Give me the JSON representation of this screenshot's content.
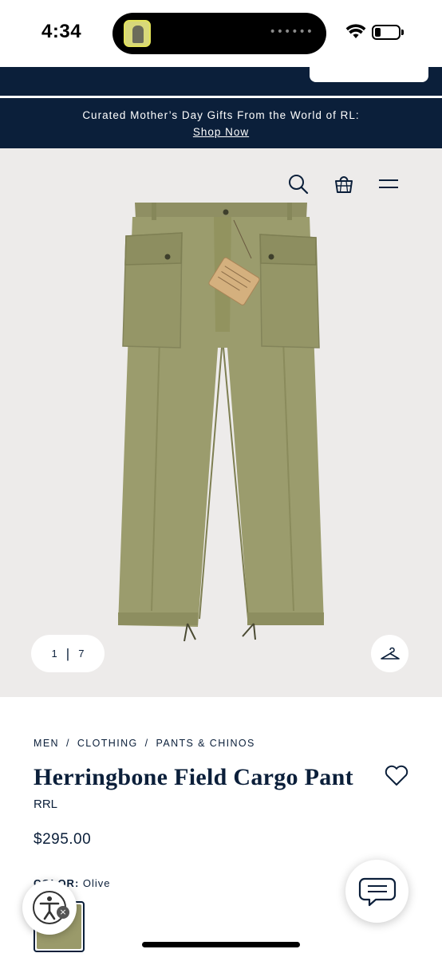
{
  "status_bar": {
    "time": "4:34",
    "island_dots": "••••••",
    "wifi_icon": "wifi-icon",
    "battery_icon": "battery-icon"
  },
  "promo": {
    "text": "Curated Mother’s Day Gifts From the World of RL:",
    "link": "Shop Now"
  },
  "hero": {
    "icons": [
      "search-icon",
      "shopping-bag-icon",
      "menu-icon"
    ],
    "pager": {
      "current": "1",
      "separator": "|",
      "total": "7"
    },
    "hanger_icon": "hanger-icon"
  },
  "product": {
    "breadcrumb": [
      "MEN",
      "CLOTHING",
      "PANTS & CHINOS"
    ],
    "breadcrumb_sep": "/",
    "title": "Herringbone Field Cargo Pant",
    "brand": "RRL",
    "price": "$295.00",
    "color_label": "COLOR:",
    "color_value": "Olive"
  },
  "colors": {
    "navy": "#0b1f3a",
    "hero_bg": "#edebea",
    "olive": "#9a9a6a"
  },
  "floating": {
    "accessibility_icon": "accessibility-icon",
    "close_glyph": "×",
    "chat_icon": "chat-icon"
  }
}
